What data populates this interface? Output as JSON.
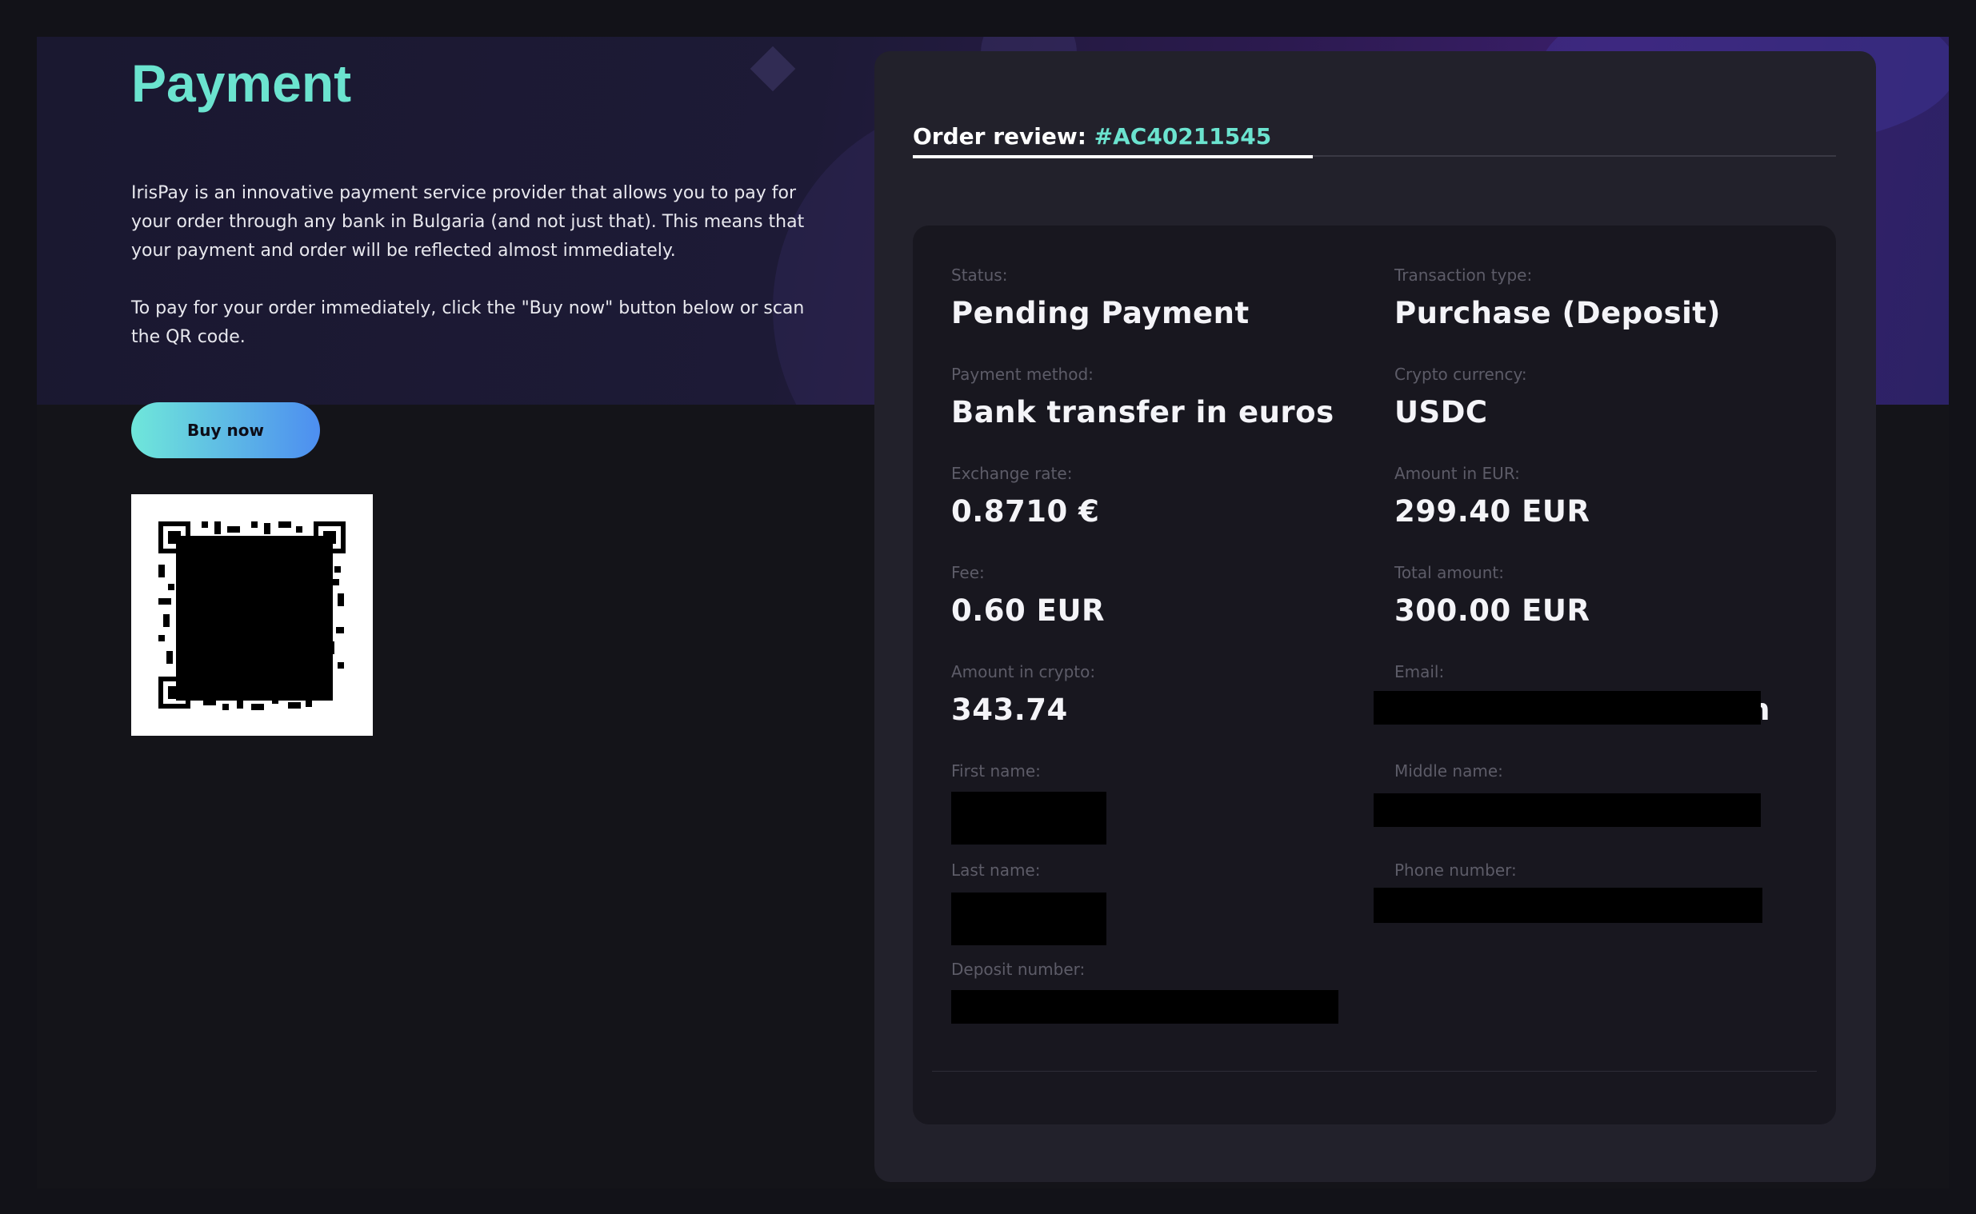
{
  "page": {
    "title": "Payment",
    "intro": [
      "IrisPay is an innovative payment service provider that allows you to pay for your order through any bank in Bulgaria (and not just that). This means that your payment and order will be reflected almost immediately.",
      "To pay for your order immediately, click the \"Buy now\" button below or scan the QR code."
    ],
    "buy_button": "Buy now"
  },
  "order": {
    "tab_label": "Order review:",
    "order_number": "#AC40211545",
    "fields": {
      "status": {
        "label": "Status:",
        "value": "Pending Payment"
      },
      "transaction_type": {
        "label": "Transaction type:",
        "value": "Purchase (Deposit)"
      },
      "payment_method": {
        "label": "Payment method:",
        "value": "Bank transfer in euros"
      },
      "crypto_currency": {
        "label": "Crypto currency:",
        "value": "USDC"
      },
      "exchange_rate": {
        "label": "Exchange rate:",
        "value": "0.8710 €"
      },
      "amount_eur": {
        "label": "Amount in EUR:",
        "value": "299.40 EUR"
      },
      "fee": {
        "label": "Fee:",
        "value": "0.60 EUR"
      },
      "total_amount": {
        "label": "Total amount:",
        "value": "300.00 EUR"
      },
      "amount_crypto": {
        "label": "Amount in crypto:",
        "value": "343.74"
      },
      "email": {
        "label": "Email:",
        "value": "n"
      },
      "first_name": {
        "label": "First name:"
      },
      "middle_name": {
        "label": "Middle name:"
      },
      "last_name": {
        "label": "Last name:"
      },
      "phone_number": {
        "label": "Phone number:"
      },
      "deposit_number": {
        "label": "Deposit number:"
      }
    }
  },
  "colors": {
    "accent": "#6be3cf",
    "button_gradient_start": "#6fe7da",
    "button_gradient_end": "#4d8ef0",
    "card_bg": "#22212b",
    "inner_bg": "#18171f"
  }
}
